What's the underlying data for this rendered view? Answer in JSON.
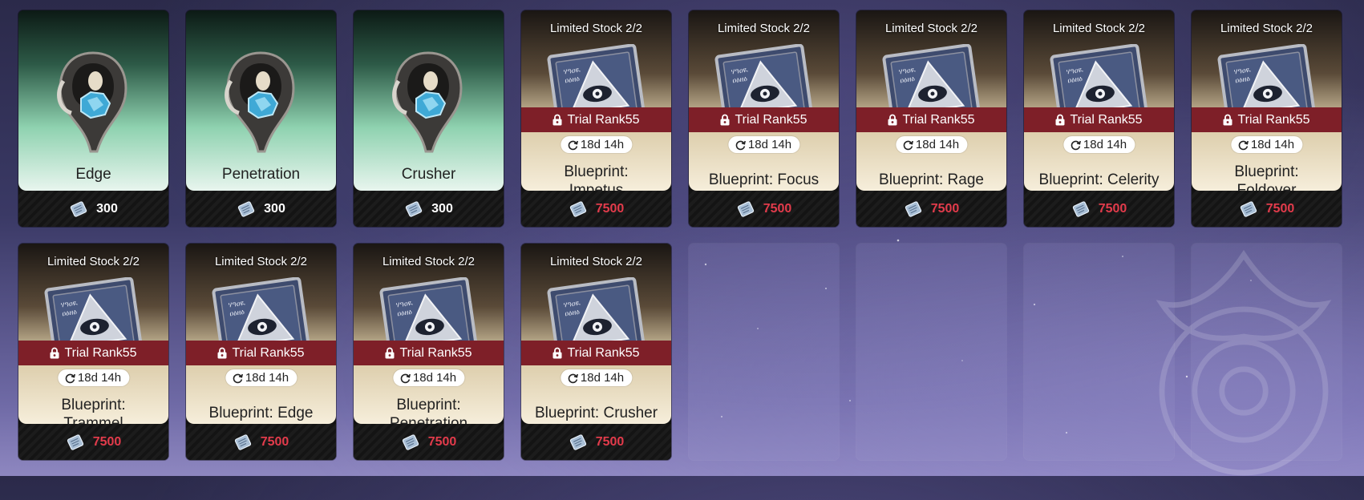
{
  "colors": {
    "price_red": "#e23b4b",
    "lock_bar": "#7e1f28"
  },
  "items": [
    {
      "type": "mod",
      "name": "Edge",
      "price": "300"
    },
    {
      "type": "mod",
      "name": "Penetration",
      "price": "300"
    },
    {
      "type": "mod",
      "name": "Crusher",
      "price": "300"
    },
    {
      "type": "blueprint",
      "stock": "Limited Stock 2/2",
      "lock": "Trial Rank55",
      "timer": "18d 14h",
      "name": "Blueprint:\nImpetus",
      "price": "7500"
    },
    {
      "type": "blueprint",
      "stock": "Limited Stock 2/2",
      "lock": "Trial Rank55",
      "timer": "18d 14h",
      "name": "Blueprint: Focus",
      "price": "7500"
    },
    {
      "type": "blueprint",
      "stock": "Limited Stock 2/2",
      "lock": "Trial Rank55",
      "timer": "18d 14h",
      "name": "Blueprint: Rage",
      "price": "7500"
    },
    {
      "type": "blueprint",
      "stock": "Limited Stock 2/2",
      "lock": "Trial Rank55",
      "timer": "18d 14h",
      "name": "Blueprint: Celerity",
      "price": "7500"
    },
    {
      "type": "blueprint",
      "stock": "Limited Stock 2/2",
      "lock": "Trial Rank55",
      "timer": "18d 14h",
      "name": "Blueprint:\nFoldover",
      "price": "7500"
    },
    {
      "type": "blueprint",
      "stock": "Limited Stock 2/2",
      "lock": "Trial Rank55",
      "timer": "18d 14h",
      "name": "Blueprint:\nTrammel",
      "price": "7500"
    },
    {
      "type": "blueprint",
      "stock": "Limited Stock 2/2",
      "lock": "Trial Rank55",
      "timer": "18d 14h",
      "name": "Blueprint: Edge",
      "price": "7500"
    },
    {
      "type": "blueprint",
      "stock": "Limited Stock 2/2",
      "lock": "Trial Rank55",
      "timer": "18d 14h",
      "name": "Blueprint:\nPenetration",
      "price": "7500"
    },
    {
      "type": "blueprint",
      "stock": "Limited Stock 2/2",
      "lock": "Trial Rank55",
      "timer": "18d 14h",
      "name": "Blueprint: Crusher",
      "price": "7500"
    },
    {
      "type": "empty"
    },
    {
      "type": "empty"
    },
    {
      "type": "empty"
    },
    {
      "type": "empty"
    }
  ]
}
